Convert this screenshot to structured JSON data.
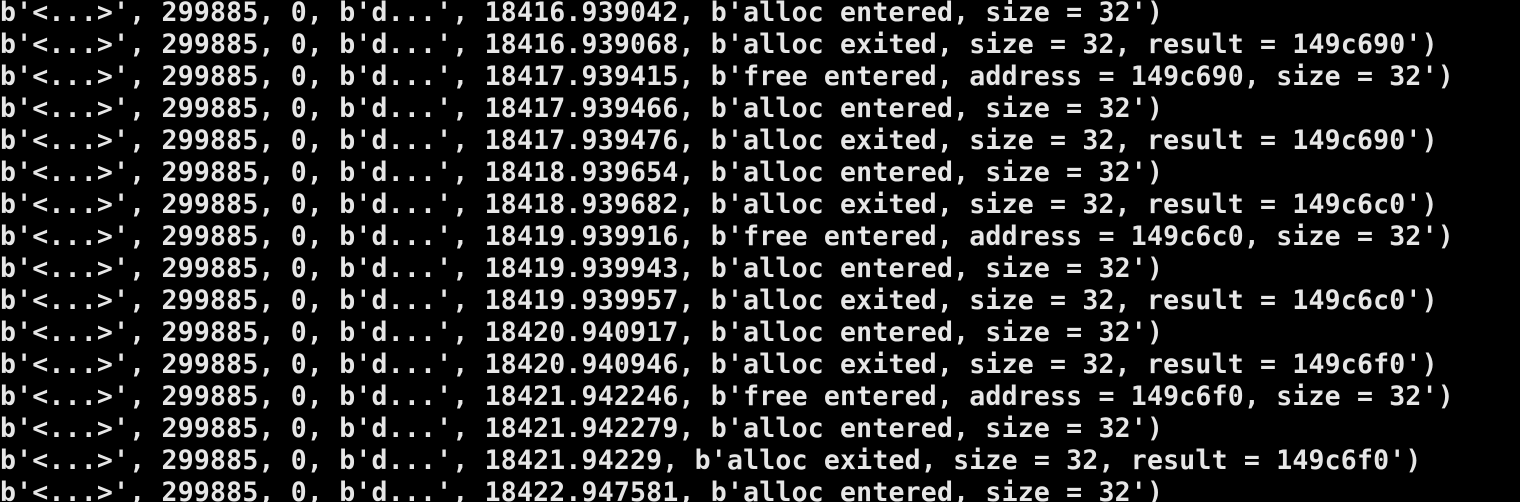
{
  "terminal": {
    "colors": {
      "background": "#000000",
      "foreground": "#e6e6e6"
    },
    "lines": [
      "b'<...>', 299885, 0, b'd...', 18416.939042, b'alloc entered, size = 32')",
      "b'<...>', 299885, 0, b'd...', 18416.939068, b'alloc exited, size = 32, result = 149c690')",
      "b'<...>', 299885, 0, b'd...', 18417.939415, b'free entered, address = 149c690, size = 32')",
      "b'<...>', 299885, 0, b'd...', 18417.939466, b'alloc entered, size = 32')",
      "b'<...>', 299885, 0, b'd...', 18417.939476, b'alloc exited, size = 32, result = 149c690')",
      "b'<...>', 299885, 0, b'd...', 18418.939654, b'alloc entered, size = 32')",
      "b'<...>', 299885, 0, b'd...', 18418.939682, b'alloc exited, size = 32, result = 149c6c0')",
      "b'<...>', 299885, 0, b'd...', 18419.939916, b'free entered, address = 149c6c0, size = 32')",
      "b'<...>', 299885, 0, b'd...', 18419.939943, b'alloc entered, size = 32')",
      "b'<...>', 299885, 0, b'd...', 18419.939957, b'alloc exited, size = 32, result = 149c6c0')",
      "b'<...>', 299885, 0, b'd...', 18420.940917, b'alloc entered, size = 32')",
      "b'<...>', 299885, 0, b'd...', 18420.940946, b'alloc exited, size = 32, result = 149c6f0')",
      "b'<...>', 299885, 0, b'd...', 18421.942246, b'free entered, address = 149c6f0, size = 32')",
      "b'<...>', 299885, 0, b'd...', 18421.942279, b'alloc entered, size = 32')",
      "b'<...>', 299885, 0, b'd...', 18421.94229, b'alloc exited, size = 32, result = 149c6f0')",
      "b'<...>', 299885, 0, b'd...', 18422.947581, b'alloc entered, size = 32')"
    ]
  }
}
